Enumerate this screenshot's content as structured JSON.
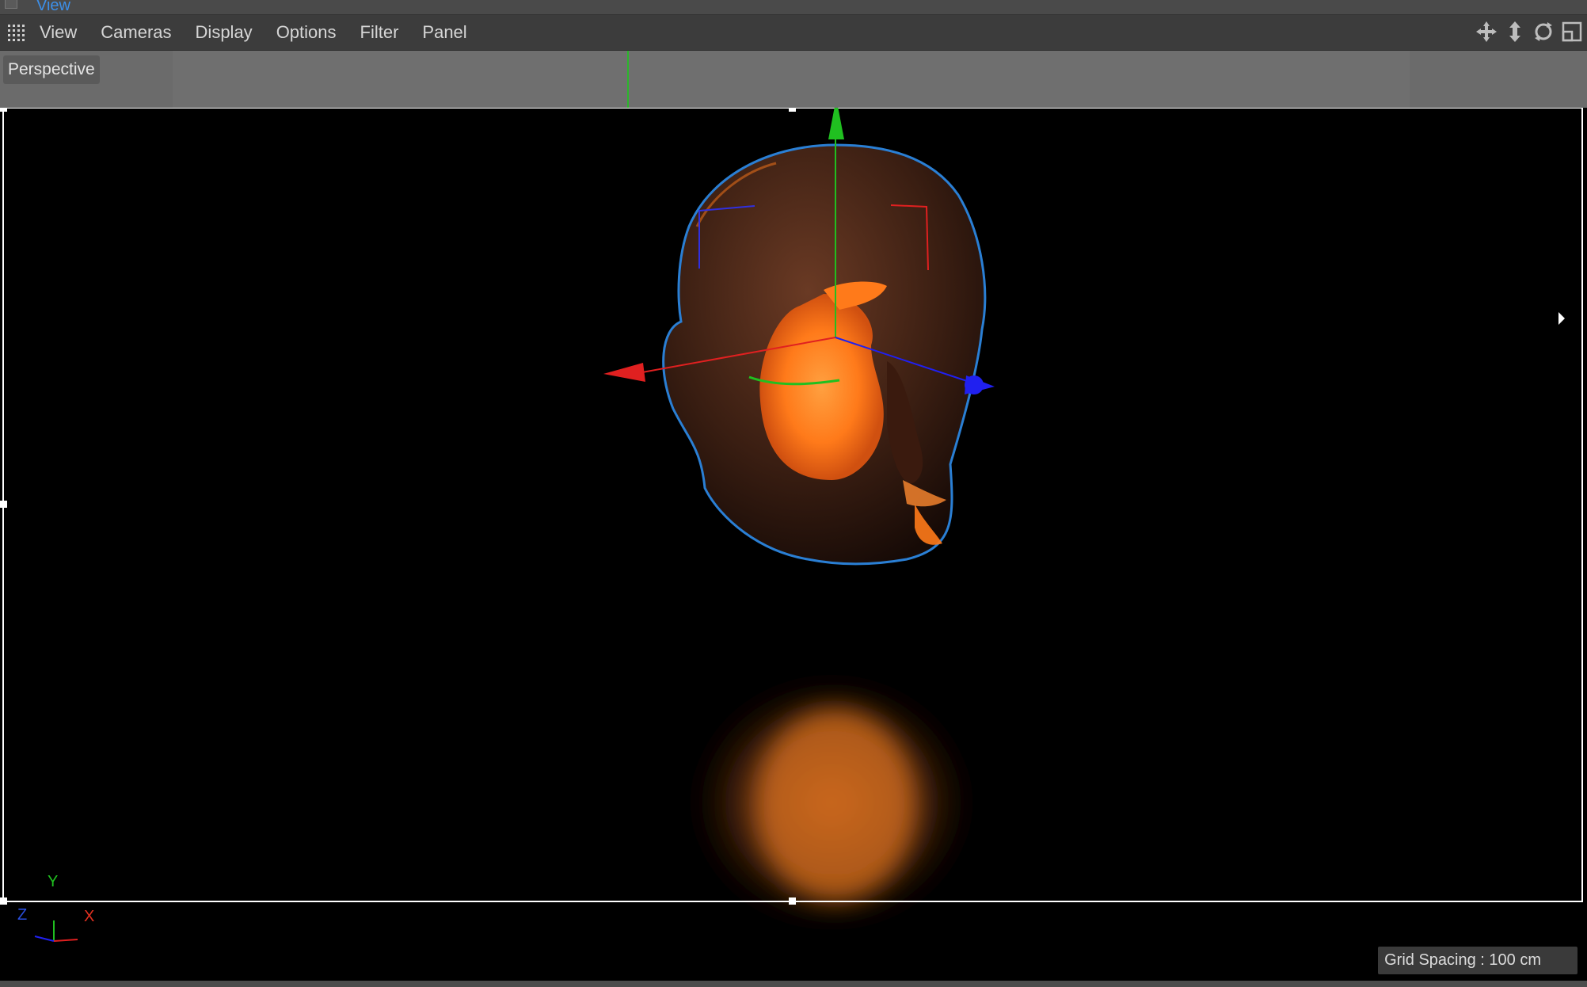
{
  "window": {
    "title": "View"
  },
  "menu": {
    "items": [
      {
        "id": "view",
        "label": "View"
      },
      {
        "id": "cameras",
        "label": "Cameras"
      },
      {
        "id": "display",
        "label": "Display"
      },
      {
        "id": "options",
        "label": "Options"
      },
      {
        "id": "filter",
        "label": "Filter"
      },
      {
        "id": "panel",
        "label": "Panel"
      }
    ]
  },
  "nav_icons": [
    "move-icon",
    "zoom-icon",
    "rotate-icon",
    "maximize-icon"
  ],
  "viewport": {
    "camera_label": "Perspective",
    "grid_spacing": "Grid Spacing : 100 cm",
    "axes": {
      "y": "Y",
      "z": "Z",
      "x": "X"
    }
  },
  "colors": {
    "selection_outline": "#2a7fd4",
    "x_axis": "#e02020",
    "y_axis": "#20c020",
    "z_axis": "#2020f0",
    "accent": "#3d8fe8",
    "head_glow": "#ff7a1a"
  }
}
